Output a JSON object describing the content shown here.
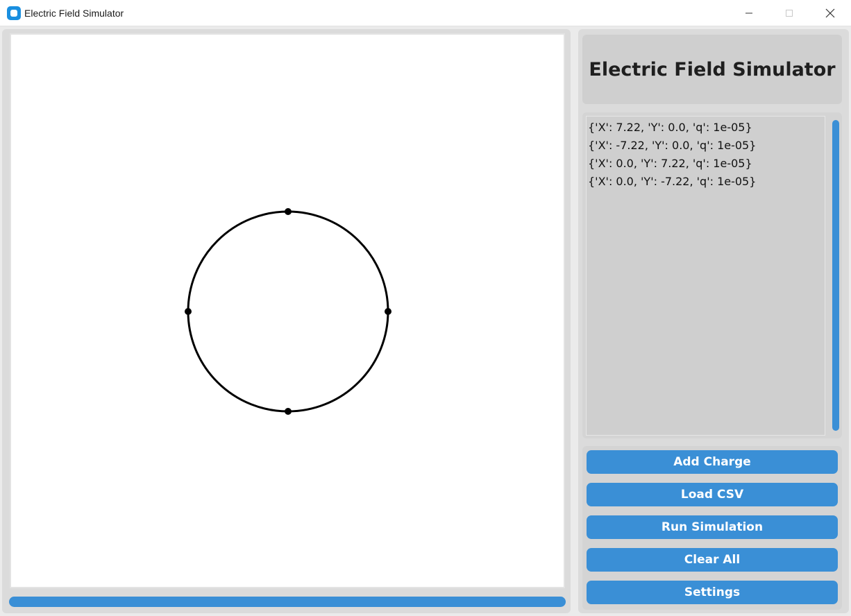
{
  "window": {
    "title": "Electric Field Simulator",
    "controls": [
      "minimize",
      "maximize",
      "close"
    ]
  },
  "header": {
    "title": "Electric Field Simulator"
  },
  "charges": [
    "{'X': 7.22, 'Y': 0.0, 'q': 1e-05}",
    "{'X': -7.22, 'Y': 0.0, 'q': 1e-05}",
    "{'X': 0.0, 'Y': 7.22, 'q': 1e-05}",
    "{'X': 0.0, 'Y': -7.22, 'q': 1e-05}"
  ],
  "buttons": {
    "add_charge": "Add Charge",
    "load_csv": "Load CSV",
    "run_simulation": "Run Simulation",
    "clear_all": "Clear All",
    "settings": "Settings"
  },
  "colors": {
    "accent": "#3a8fd6",
    "panel": "#dbdbdb",
    "canvas_background": "#ffffff",
    "charge_marker": "#000000"
  },
  "icons": {
    "app": "app-icon",
    "minimize": "minimize-icon",
    "maximize": "maximize-icon",
    "close": "close-icon"
  }
}
